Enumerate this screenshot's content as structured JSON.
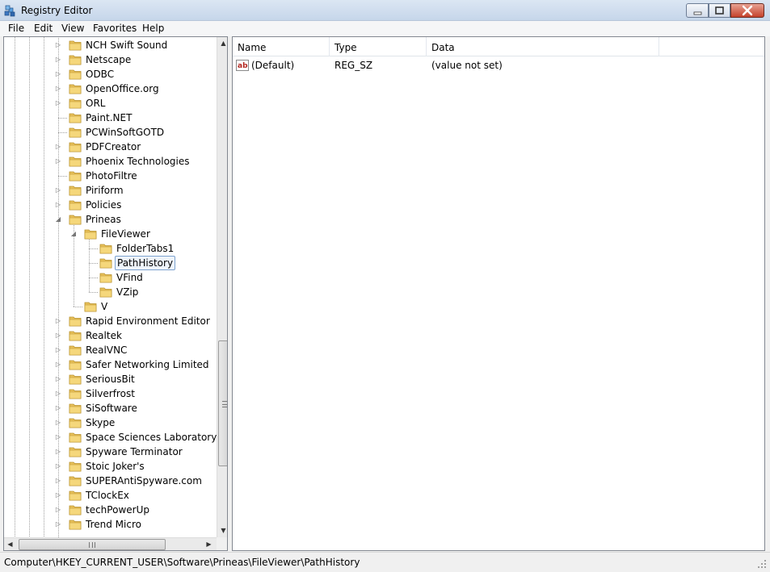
{
  "window": {
    "title": "Registry Editor"
  },
  "menu": [
    "File",
    "Edit",
    "View",
    "Favorites",
    "Help"
  ],
  "tree": [
    {
      "label": "NCH Swift Sound",
      "level": 0,
      "expander": "collapsed"
    },
    {
      "label": "Netscape",
      "level": 0,
      "expander": "collapsed"
    },
    {
      "label": "ODBC",
      "level": 0,
      "expander": "collapsed"
    },
    {
      "label": "OpenOffice.org",
      "level": 0,
      "expander": "collapsed"
    },
    {
      "label": "ORL",
      "level": 0,
      "expander": "collapsed"
    },
    {
      "label": "Paint.NET",
      "level": 0,
      "expander": "none"
    },
    {
      "label": "PCWinSoftGOTD",
      "level": 0,
      "expander": "none"
    },
    {
      "label": "PDFCreator",
      "level": 0,
      "expander": "collapsed"
    },
    {
      "label": "Phoenix Technologies",
      "level": 0,
      "expander": "collapsed"
    },
    {
      "label": "PhotoFiltre",
      "level": 0,
      "expander": "none"
    },
    {
      "label": "Piriform",
      "level": 0,
      "expander": "collapsed"
    },
    {
      "label": "Policies",
      "level": 0,
      "expander": "collapsed"
    },
    {
      "label": "Prineas",
      "level": 0,
      "expander": "expanded"
    },
    {
      "label": "FileViewer",
      "level": 1,
      "expander": "expanded"
    },
    {
      "label": "FolderTabs1",
      "level": 2,
      "expander": "none"
    },
    {
      "label": "PathHistory",
      "level": 2,
      "expander": "none",
      "selected": true
    },
    {
      "label": "VFind",
      "level": 2,
      "expander": "none"
    },
    {
      "label": "VZip",
      "level": 2,
      "expander": "none"
    },
    {
      "label": "V",
      "level": 1,
      "expander": "none"
    },
    {
      "label": "Rapid Environment Editor",
      "level": 0,
      "expander": "collapsed"
    },
    {
      "label": "Realtek",
      "level": 0,
      "expander": "collapsed"
    },
    {
      "label": "RealVNC",
      "level": 0,
      "expander": "collapsed"
    },
    {
      "label": "Safer Networking Limited",
      "level": 0,
      "expander": "collapsed"
    },
    {
      "label": "SeriousBit",
      "level": 0,
      "expander": "collapsed"
    },
    {
      "label": "Silverfrost",
      "level": 0,
      "expander": "collapsed"
    },
    {
      "label": "SiSoftware",
      "level": 0,
      "expander": "collapsed"
    },
    {
      "label": "Skype",
      "level": 0,
      "expander": "collapsed"
    },
    {
      "label": "Space Sciences Laboratory, U.C",
      "level": 0,
      "expander": "collapsed"
    },
    {
      "label": "Spyware Terminator",
      "level": 0,
      "expander": "collapsed"
    },
    {
      "label": "Stoic Joker's",
      "level": 0,
      "expander": "collapsed"
    },
    {
      "label": "SUPERAntiSpyware.com",
      "level": 0,
      "expander": "collapsed"
    },
    {
      "label": "TClockEx",
      "level": 0,
      "expander": "collapsed"
    },
    {
      "label": "techPowerUp",
      "level": 0,
      "expander": "collapsed"
    },
    {
      "label": "Trend Micro",
      "level": 0,
      "expander": "collapsed"
    }
  ],
  "list": {
    "columns": [
      "Name",
      "Type",
      "Data"
    ],
    "rows": [
      {
        "icon": "string-value-icon",
        "name": "(Default)",
        "type": "REG_SZ",
        "data": "(value not set)"
      }
    ]
  },
  "status": {
    "path": "Computer\\HKEY_CURRENT_USER\\Software\\Prineas\\FileViewer\\PathHistory"
  },
  "colors": {
    "folder": "#e8c15a",
    "selection_border": "#7da2ce",
    "close_button": "#c4412b"
  }
}
